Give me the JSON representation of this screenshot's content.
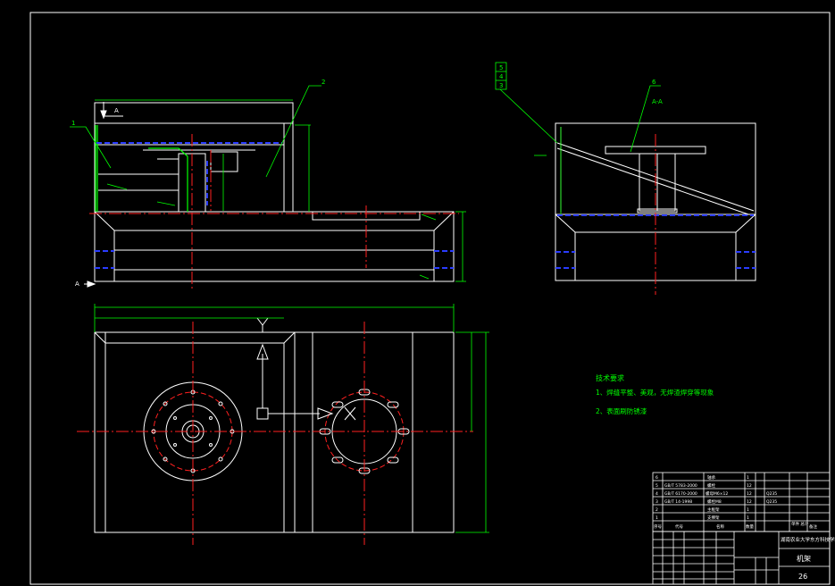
{
  "colors": {
    "background": "#000000",
    "outline": "#ffffff",
    "center_line": "#ff2020",
    "dimension": "#00ff00",
    "hidden_line": "#2a3cff",
    "leader": "#00ff00",
    "note_text": "#00ff00",
    "title_block": "#ffffff"
  },
  "labels": {
    "section_mark_a": "A",
    "section_title": "A-A",
    "balloon_1": "1",
    "balloon_2": "2",
    "balloon_6": "6",
    "stack_5": "5",
    "stack_4": "4",
    "stack_3": "3"
  },
  "notes": {
    "heading": "技术要求",
    "item1": "1、焊缝平整、美观，无焊渣焊穿等现象",
    "item2": "2、表面刷防锈漆"
  },
  "title_block": {
    "drawing_name": "机架",
    "sheet_number": "26",
    "school": "湖南农业大学东方科技学院"
  },
  "parts_list": [
    {
      "no": "6",
      "code": "",
      "name": "轴承",
      "qty": "1",
      "note": ""
    },
    {
      "no": "5",
      "code": "GB/T 5783-2000",
      "name": "螺栓",
      "qty": "12",
      "note": ""
    },
    {
      "no": "4",
      "code": "GB/T 6170-2000",
      "name": "螺母M6×12",
      "qty": "12",
      "note": "Q235"
    },
    {
      "no": "3",
      "code": "GB/T 14-1998",
      "name": "螺栓M8",
      "qty": "12",
      "note": "Q235"
    },
    {
      "no": "2",
      "code": "",
      "name": "主框架",
      "qty": "1",
      "note": ""
    },
    {
      "no": "1",
      "code": "",
      "name": "支撑架",
      "qty": "1",
      "note": ""
    }
  ],
  "parts_header": {
    "no": "序号",
    "code": "代号",
    "name": "名称",
    "qty": "数量",
    "mass": "单件 总计",
    "note": "备注"
  }
}
